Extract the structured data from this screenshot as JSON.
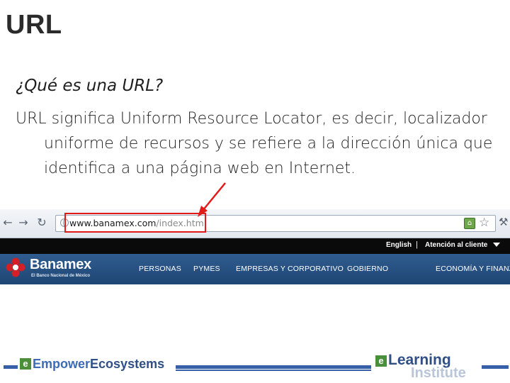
{
  "slide": {
    "title": "URL",
    "question": "¿Qué es una URL?",
    "body": "URL significa Uniform Resource Locator, es decir, localizador uniforme de recursos y se refiere a la dirección única que identifica a una página web en Internet."
  },
  "browser": {
    "url_host": "www.banamex.com",
    "url_path": "/index.htm",
    "icons": [
      "back-icon",
      "forward-icon",
      "reload-icon",
      "globe-icon",
      "extension-icon",
      "star-icon",
      "wrench-icon"
    ]
  },
  "site": {
    "lang_link": "English",
    "separator": "|",
    "client_link": "Atención al cliente",
    "logo_text": "Banamex",
    "logo_sub": "El Banco Nacional de México",
    "nav": [
      "PERSONAS",
      "PYMES",
      "EMPRESAS Y CORPORATIVO",
      "GOBIERNO",
      "ECONOMÍA Y FINANZAS"
    ]
  },
  "footer": {
    "left_logo_e": "e",
    "left_logo_part1": "Empower",
    "left_logo_part2": "Ecosystems",
    "right_logo_e": "e",
    "right_logo_main": "Learning",
    "right_logo_sub": "Institute"
  },
  "colors": {
    "highlight": "#e21a1a",
    "nav_bg": "#1f4674",
    "brand_blue": "#2f4f86",
    "brand_green": "#4c8f3a"
  }
}
